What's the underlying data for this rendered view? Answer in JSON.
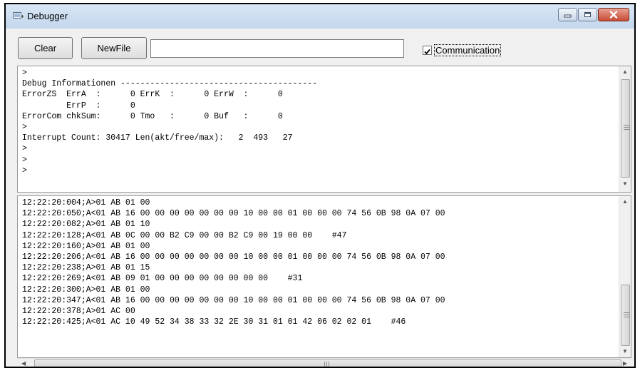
{
  "window": {
    "title": "Debugger"
  },
  "toolbar": {
    "clear_label": "Clear",
    "newfile_label": "NewFile",
    "file_value": "",
    "communication_label": "Communication",
    "communication_checked": true
  },
  "debug_pane": {
    "lines": [
      ">",
      "Debug Informationen ----------------------------------------",
      "ErrorZS  ErrA  :      0 ErrK  :      0 ErrW  :      0",
      "         ErrP  :      0",
      "ErrorCom chkSum:      0 Tmo   :      0 Buf   :      0",
      ">",
      "Interrupt Count: 30417 Len(akt/free/max):   2  493   27",
      ">",
      ">",
      ">"
    ]
  },
  "log_pane": {
    "lines": [
      "12:22:20:004;A>01 AB 01 00",
      "12:22:20:050;A<01 AB 16 00 00 00 00 00 00 00 10 00 00 01 00 00 00 74 56 0B 98 0A 07 00",
      "12:22:20:082;A>01 AB 01 10",
      "12:22:20:128;A<01 AB 0C 00 00 B2 C9 00 00 B2 C9 00 19 00 00    #47",
      "12:22:20:160;A>01 AB 01 00",
      "12:22:20:206;A<01 AB 16 00 00 00 00 00 00 00 10 00 00 01 00 00 00 74 56 0B 98 0A 07 00",
      "12:22:20:238;A>01 AB 01 15",
      "12:22:20:269;A<01 AB 09 01 00 00 00 00 00 00 00 00    #31",
      "12:22:20:300;A>01 AB 01 00",
      "12:22:20:347;A<01 AB 16 00 00 00 00 00 00 00 10 00 00 01 00 00 00 74 56 0B 98 0A 07 00",
      "12:22:20:378;A>01 AC 00",
      "12:22:20:425;A<01 AC 10 49 52 34 38 33 32 2E 30 31 01 01 42 06 02 02 01    #46"
    ]
  },
  "icons": {
    "window": "debugger-window-icon",
    "minimize": "minimize-icon",
    "maximize": "maximize-icon",
    "close": "close-icon",
    "checkbox": "checkmark-icon"
  },
  "colors": {
    "titlebar": "#c9dbef",
    "close_button": "#c74a33",
    "pane_background": "#ffffff"
  }
}
